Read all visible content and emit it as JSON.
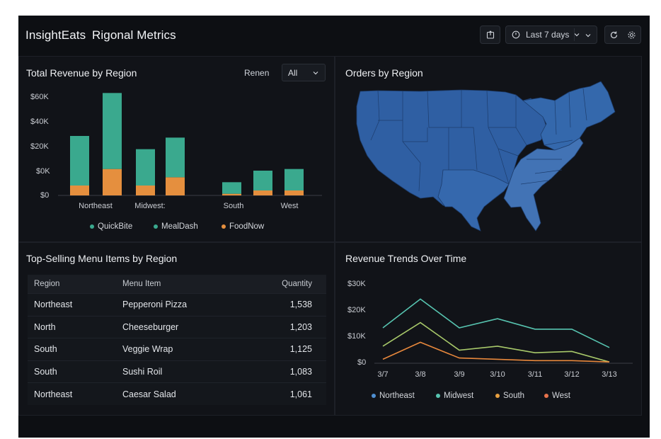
{
  "header": {
    "app_name": "InsightEats",
    "page_title": "Rigonal Metrics",
    "date_range_label": "Last 7 days"
  },
  "colors": {
    "quickbite": "#3aa98e",
    "foodnow": "#e58f3e",
    "map_fill": "#2f5fa3",
    "map_south_fill": "#4273b5",
    "northeast_line": "#57c4b0",
    "midwest_line": "#a8c96a",
    "south_line": "#e8883c",
    "west_line": "#e8734c"
  },
  "revenue_panel": {
    "title": "Total Revenue by Region",
    "filter_label": "Renen",
    "filter_value": "All"
  },
  "orders_panel": {
    "title": "Orders by Region"
  },
  "menu_panel": {
    "title": "Top-Selling Menu Items by Region",
    "columns": [
      "Region",
      "Menu Item",
      "Quantity"
    ],
    "rows": [
      {
        "region": "Northeast",
        "item": "Pepperoni Pizza",
        "qty": "1,538"
      },
      {
        "region": "North",
        "item": "Cheeseburger",
        "qty": "1,203"
      },
      {
        "region": "South",
        "item": "Veggie Wrap",
        "qty": "1,125"
      },
      {
        "region": "South",
        "item": "Sushi Roil",
        "qty": "1,083"
      },
      {
        "region": "Northeast",
        "item": "Caesar Salad",
        "qty": "1,061"
      }
    ]
  },
  "trends_panel": {
    "title": "Revenue Trends Over Time"
  },
  "chart_data": [
    {
      "type": "bar",
      "stacked": true,
      "title": "Total Revenue by Region",
      "categories": [
        "Northeast",
        "Northeast",
        "Midwest:",
        "Midwest:",
        "South",
        "South",
        "West",
        "West"
      ],
      "category_labels": [
        "Northeast",
        "Midwest:",
        "South",
        "West"
      ],
      "y_ticks": [
        "$60K",
        "$40K",
        "$20K",
        "$0K",
        "$0"
      ],
      "ylim": [
        0,
        60
      ],
      "series": [
        {
          "name": "FoodNow",
          "values": [
            6,
            16,
            6,
            11,
            1,
            3,
            3,
            3
          ]
        },
        {
          "name": "QuickBite",
          "values": [
            30,
            46,
            22,
            24,
            7,
            12,
            13,
            13
          ]
        }
      ],
      "legend": [
        "QuickBite",
        "MealDash",
        "FoodNow"
      ],
      "legend_position": "bottom"
    },
    {
      "type": "line",
      "title": "Revenue Trends Over Time",
      "x": [
        "3/7",
        "3/8",
        "3/9",
        "3/10",
        "3/11",
        "3/12",
        "3/13"
      ],
      "y_ticks": [
        "$30K",
        "$20K",
        "$10K",
        "$0"
      ],
      "ylim": [
        0,
        30
      ],
      "series": [
        {
          "name": "Northeast",
          "values": [
            13.5,
            24.5,
            13.5,
            17,
            13,
            13,
            6
          ]
        },
        {
          "name": "Midwest",
          "values": [
            6.5,
            15.5,
            5,
            6.5,
            4,
            4.5,
            0.5
          ]
        },
        {
          "name": "South",
          "values": [
            1.5,
            8,
            2,
            1.5,
            1,
            1,
            0.5
          ]
        }
      ],
      "legend": [
        "Northeast",
        "Midwest",
        "South",
        "West"
      ],
      "legend_position": "bottom"
    }
  ]
}
